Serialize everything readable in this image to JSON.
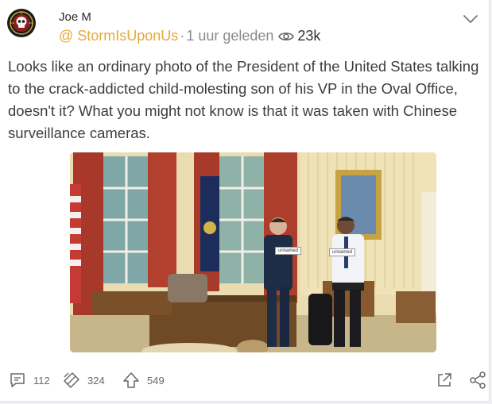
{
  "post": {
    "author": "Joe M",
    "handle": "@ StormIsUponUs",
    "separator": "·",
    "time": "1 uur geleden",
    "views": "23k",
    "body": "Looks like an ordinary photo of the President of the United States talking to the crack-addicted child-molesting son of his VP in the Oval Office, doesn't it? What you might not know is that it was taken with Chinese surveillance cameras.",
    "photo_tags": [
      "unnamed",
      "unnamed"
    ]
  },
  "actions": {
    "comments": "112",
    "reposts": "324",
    "upvotes": "549"
  },
  "icons": {
    "avatar": "skull-avatar-icon",
    "views": "eye-icon",
    "menu": "chevron-down-icon",
    "comments": "comment-icon",
    "reposts": "repost-icon",
    "upvotes": "upvote-arrow-icon",
    "share": "share-external-icon",
    "network": "share-network-icon"
  },
  "colors": {
    "handle": "#e4a93c",
    "meta": "#8a8a8a",
    "body_text": "#3d3d3d"
  }
}
